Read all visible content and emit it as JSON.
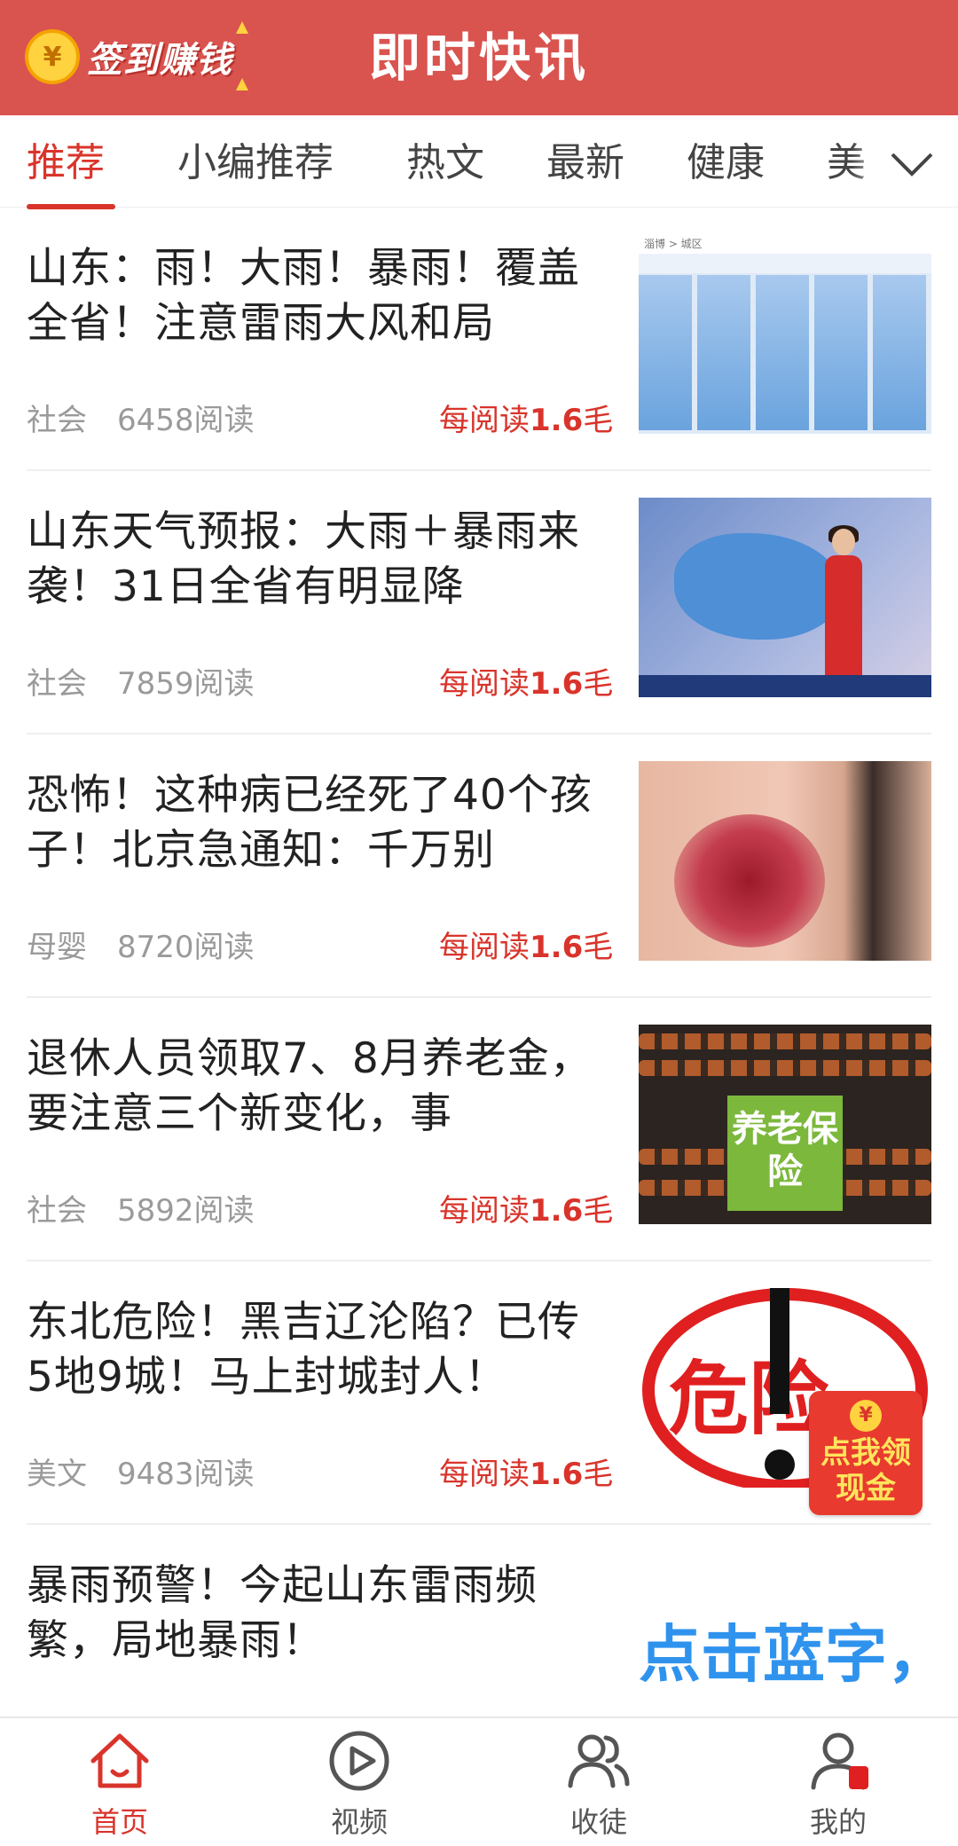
{
  "header": {
    "sign_in_label": "签到赚钱",
    "coin_symbol": "¥",
    "app_title": "即时快讯"
  },
  "tabs": {
    "items": [
      "推荐",
      "小编推荐",
      "热文",
      "最新",
      "健康",
      "美"
    ],
    "active_index": 0,
    "more_icon": "chevron-down-icon"
  },
  "feed": {
    "items": [
      {
        "title": "山东：雨！大雨！暴雨！覆盖全省！注意雷雨大风和局",
        "category": "社会",
        "reads": "6458阅读",
        "reward_prefix": "每阅读",
        "reward_amount": "1.6",
        "reward_unit": "毛"
      },
      {
        "title": "山东天气预报：大雨＋暴雨来袭！31日全省有明显降",
        "category": "社会",
        "reads": "7859阅读",
        "reward_prefix": "每阅读",
        "reward_amount": "1.6",
        "reward_unit": "毛"
      },
      {
        "title": "恐怖！这种病已经死了40个孩子！北京急通知：千万别",
        "category": "母婴",
        "reads": "8720阅读",
        "reward_prefix": "每阅读",
        "reward_amount": "1.6",
        "reward_unit": "毛"
      },
      {
        "title": "退休人员领取7、8月养老金，要注意三个新变化，事",
        "category": "社会",
        "reads": "5892阅读",
        "reward_prefix": "每阅读",
        "reward_amount": "1.6",
        "reward_unit": "毛"
      },
      {
        "title": "东北危险！黑吉辽沦陷？已传5地9城！马上封城封人！",
        "category": "美文",
        "reads": "9483阅读",
        "reward_prefix": "每阅读",
        "reward_amount": "1.6",
        "reward_unit": "毛"
      },
      {
        "title": "暴雨预警！今起山东雷雨频繁，局地暴雨！",
        "category": "",
        "reads": "",
        "reward_prefix": "",
        "reward_amount": "",
        "reward_unit": ""
      }
    ],
    "thumb_texts": {
      "weather_bar": "淄博 > 城区",
      "insurance": "养老保险",
      "danger": "危险",
      "blue_text": "点击蓝字，"
    }
  },
  "red_packet": {
    "coin_symbol": "¥",
    "label": "点我领现金"
  },
  "bottom_nav": {
    "items": [
      {
        "label": "首页",
        "icon": "home-icon"
      },
      {
        "label": "视频",
        "icon": "play-icon"
      },
      {
        "label": "收徒",
        "icon": "users-icon"
      },
      {
        "label": "我的",
        "icon": "user-icon"
      }
    ],
    "active_index": 0
  },
  "colors": {
    "header_bg": "#d9534f",
    "accent_red": "#d9342b",
    "muted_gray": "#9a9a9a"
  }
}
